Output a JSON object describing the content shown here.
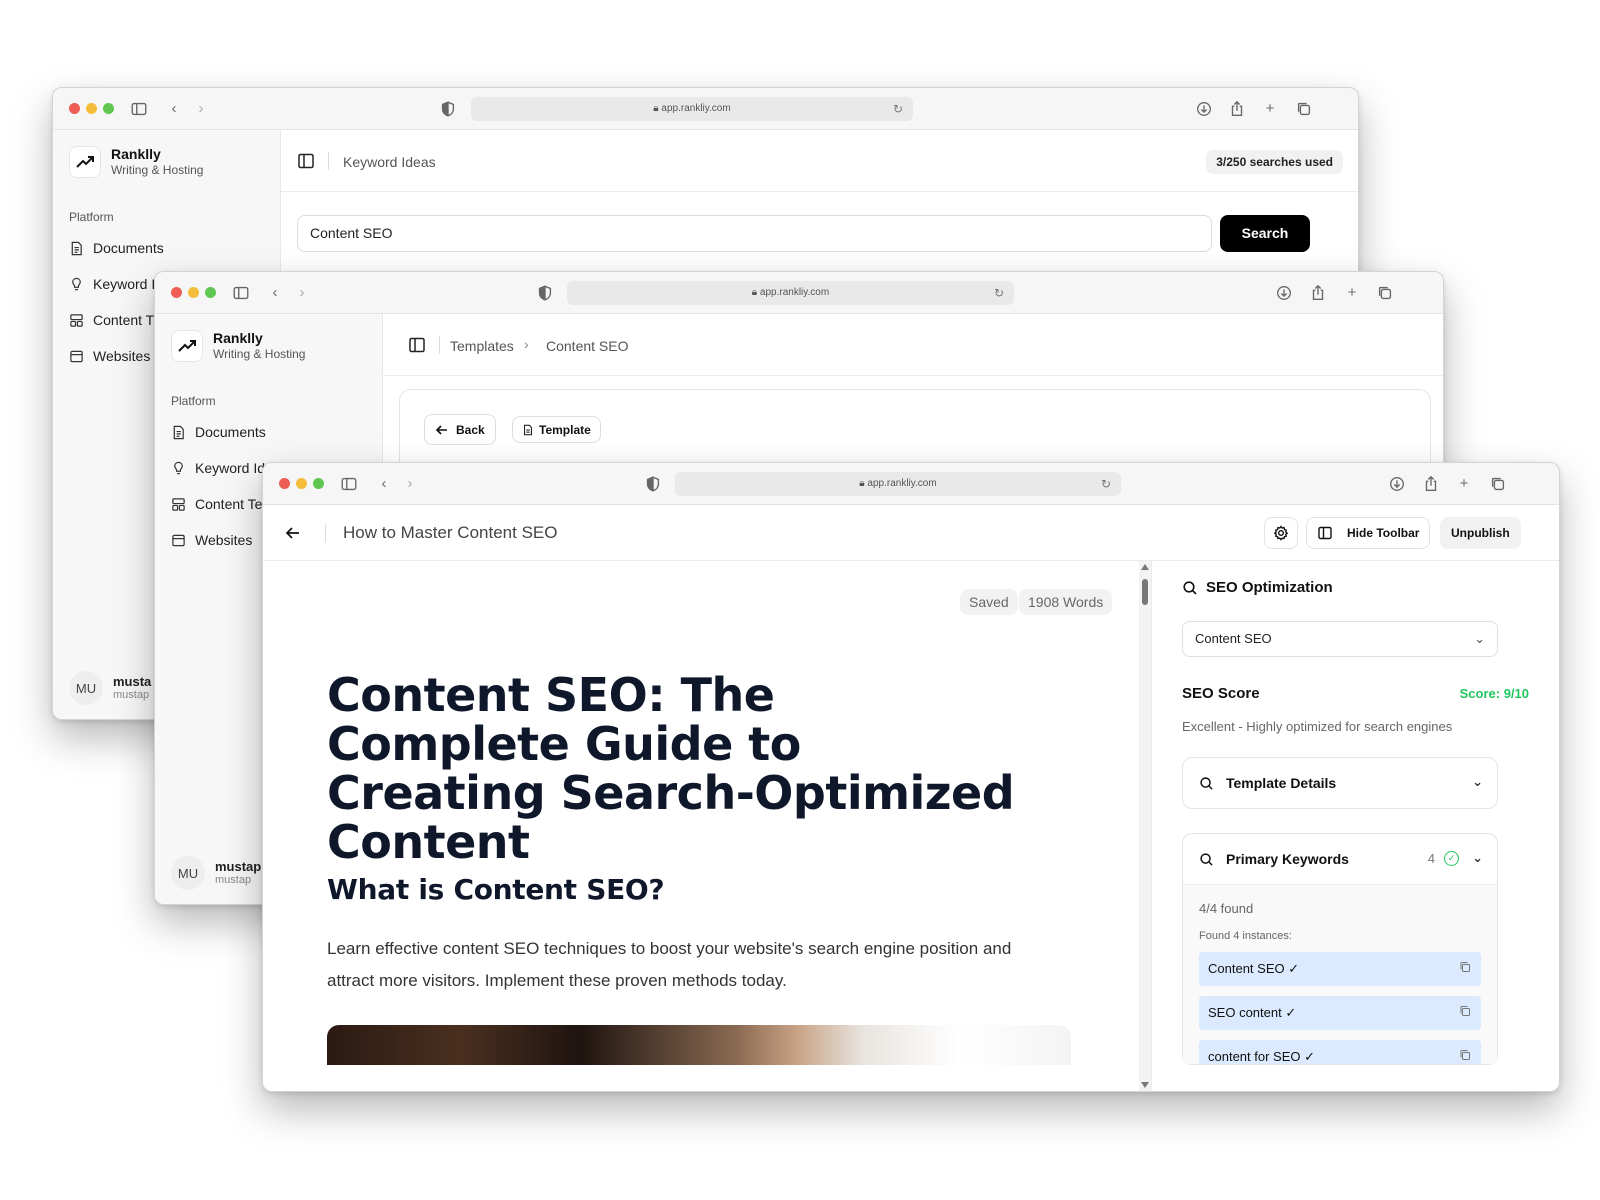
{
  "browser": {
    "url": "app.rankliy.com"
  },
  "brand": {
    "name": "Ranklly",
    "tagline": "Writing & Hosting"
  },
  "sidebar": {
    "section": "Platform",
    "w1_items": [
      "Documents",
      "Keyword I",
      "Content T",
      "Websites"
    ],
    "w2_items": [
      "Documents",
      "Keyword Id",
      "Content Te",
      "Websites"
    ]
  },
  "user": {
    "initials": "MU",
    "w1_name": "musta",
    "w1_email": "mustap",
    "w2_name": "mustap",
    "w2_email": "mustap"
  },
  "window1": {
    "page": "Keyword Ideas",
    "usage": "3/250 searches used",
    "search_value": "Content SEO",
    "search_button": "Search"
  },
  "window2": {
    "breadcrumb": [
      "Templates",
      "Content SEO"
    ],
    "back_button": "Back",
    "template_button": "Template"
  },
  "editor": {
    "doc_title": "How to Master Content SEO",
    "hide_toolbar": "Hide Toolbar",
    "unpublish": "Unpublish",
    "saved": "Saved",
    "words": "1908 Words",
    "h1": "Content SEO: The Complete Guide to Creating Search-Optimized Content",
    "h2": "What is Content SEO?",
    "paragraph": "Learn effective content SEO techniques to boost your website's search engine position and attract more visitors. Implement these proven methods today."
  },
  "seo_panel": {
    "title": "SEO Optimization",
    "selected_template": "Content SEO",
    "score_label": "SEO Score",
    "score_value": "Score: 9/10",
    "score_description": "Excellent - Highly optimized for search engines",
    "template_details": "Template Details",
    "primary_keywords": "Primary Keywords",
    "primary_count": "4",
    "found": "4/4 found",
    "found_instances": "Found 4 instances:",
    "keywords": [
      "Content SEO ✓",
      "SEO content ✓",
      "content for SEO ✓"
    ]
  },
  "colors": {
    "accent_green": "#22c55e",
    "keyword_highlight": "#dbeafe",
    "primary_button": "#000000"
  }
}
